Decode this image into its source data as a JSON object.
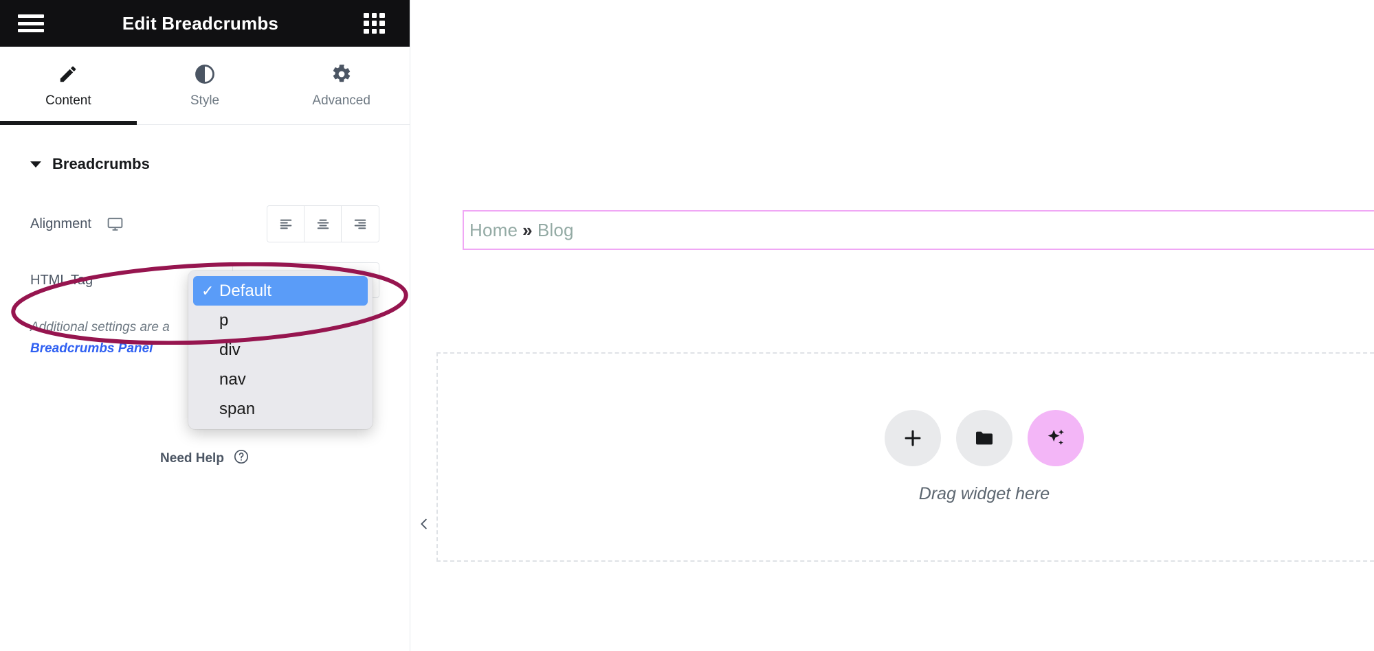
{
  "panel": {
    "header": {
      "title": "Edit Breadcrumbs",
      "menu_icon": "hamburger-icon",
      "apps_icon": "grid-apps-icon"
    },
    "tabs": [
      {
        "label": "Content",
        "icon": "pencil-icon",
        "active": true
      },
      {
        "label": "Style",
        "icon": "contrast-circle-icon",
        "active": false
      },
      {
        "label": "Advanced",
        "icon": "gear-icon",
        "active": false
      }
    ],
    "section": {
      "title": "Breadcrumbs",
      "collapse_icon": "caret-down-icon"
    },
    "controls": {
      "alignment": {
        "label": "Alignment",
        "device_icon": "desktop-icon",
        "options": [
          {
            "name": "align-left",
            "icon": "align-left-icon"
          },
          {
            "name": "align-center",
            "icon": "align-center-icon"
          },
          {
            "name": "align-right",
            "icon": "align-right-icon"
          }
        ]
      },
      "html_tag": {
        "label": "HTML Tag",
        "value": "Default",
        "caret_icon": "chevron-down-icon",
        "dropdown_open": true,
        "options": [
          {
            "label": "Default",
            "selected": true
          },
          {
            "label": "p",
            "selected": false
          },
          {
            "label": "div",
            "selected": false
          },
          {
            "label": "nav",
            "selected": false
          },
          {
            "label": "span",
            "selected": false
          }
        ]
      }
    },
    "hint": {
      "text": "Additional settings are a",
      "link": "Breadcrumbs Panel"
    },
    "need_help": {
      "label": "Need Help",
      "icon": "question-circle-icon"
    }
  },
  "canvas": {
    "breadcrumb": {
      "items": [
        "Home",
        "Blog"
      ],
      "separator": "»",
      "highlight_color": "#f0a7f5",
      "text_color": "#93aaa4"
    },
    "drop_area": {
      "label": "Drag widget here",
      "buttons": [
        {
          "name": "add-widget-button",
          "icon": "plus-icon"
        },
        {
          "name": "add-template-button",
          "icon": "folder-icon"
        },
        {
          "name": "ai-generate-button",
          "icon": "sparkles-icon"
        }
      ]
    },
    "collapse_panel": {
      "icon": "chevron-left-icon"
    }
  },
  "annotation": {
    "shape": "ellipse",
    "color": "#96154f",
    "target": "HTML Tag"
  }
}
